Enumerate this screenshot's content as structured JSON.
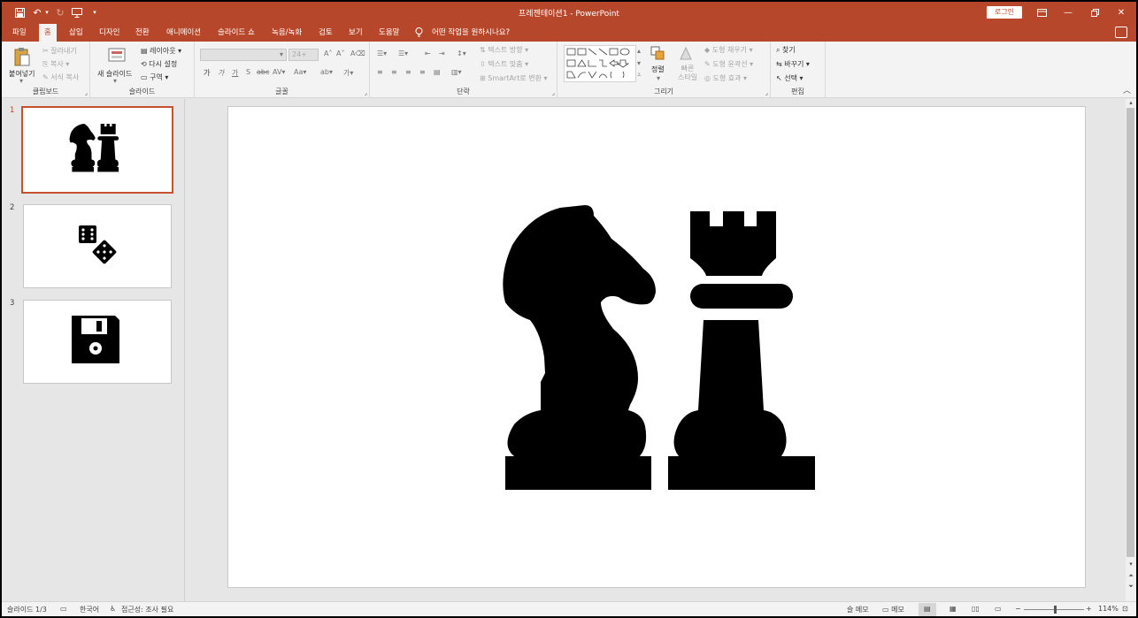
{
  "window": {
    "title": "프레젠테이션1  -  PowerPoint",
    "login_label": "로그인"
  },
  "menu": {
    "tabs": [
      {
        "label": "파일"
      },
      {
        "label": "홈"
      },
      {
        "label": "삽입"
      },
      {
        "label": "디자인"
      },
      {
        "label": "전환"
      },
      {
        "label": "애니메이션"
      },
      {
        "label": "슬라이드 쇼"
      },
      {
        "label": "녹음/녹화"
      },
      {
        "label": "검토"
      },
      {
        "label": "보기"
      },
      {
        "label": "도움말"
      }
    ],
    "tell_me": "어떤 작업을 원하시나요?"
  },
  "ribbon": {
    "clipboard": {
      "paste": "붙여넣기",
      "cut": "잘라내기",
      "copy": "복사",
      "format_painter": "서식 복사",
      "label": "클립보드"
    },
    "slides": {
      "new_slide": "새 슬라이드",
      "layout": "레이아웃",
      "reset": "다시 설정",
      "section": "구역",
      "label": "슬라이드"
    },
    "font": {
      "size": "24+",
      "label": "글꼴"
    },
    "paragraph": {
      "text_direction": "텍스트 방향",
      "align_text": "텍스트 맞춤",
      "smartart": "SmartArt로 변환",
      "label": "단락"
    },
    "drawing": {
      "arrange": "정렬",
      "quick_styles": "빠른\n스타일",
      "shape_fill": "도형 채우기",
      "shape_outline": "도형 윤곽선",
      "shape_effects": "도형 효과",
      "label": "그리기"
    },
    "editing": {
      "find": "찾기",
      "replace": "바꾸기",
      "select": "선택",
      "label": "편집"
    }
  },
  "slides": [
    {
      "number": "1",
      "icon": "chess-knight-rook-icon"
    },
    {
      "number": "2",
      "icon": "dice-icon"
    },
    {
      "number": "3",
      "icon": "floppy-disk-icon"
    }
  ],
  "status": {
    "slide_count": "슬라이드 1/3",
    "language": "한국어",
    "accessibility": "접근성: 조사 필요",
    "notes": "슬 메모",
    "comments": "메모",
    "zoom": "114%"
  },
  "colors": {
    "accent": "#b7472a",
    "selected_thumb_border": "#c5512f"
  }
}
